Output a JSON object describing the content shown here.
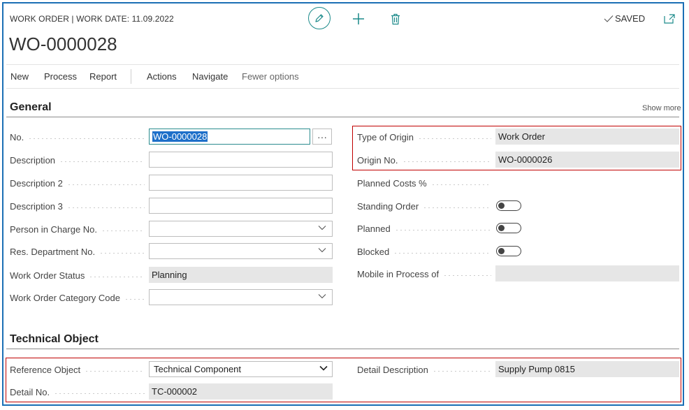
{
  "header": {
    "caption": "WORK ORDER | WORK DATE: 11.09.2022",
    "title": "WO-0000028",
    "saved_label": "SAVED"
  },
  "menu": {
    "items": [
      "New",
      "Process",
      "Report",
      "Actions",
      "Navigate"
    ],
    "fewer_options": "Fewer options"
  },
  "general": {
    "title": "General",
    "show_more": "Show more",
    "no_label": "No.",
    "no_value": "WO-0000028",
    "ellipsis": "···",
    "description_label": "Description",
    "description2_label": "Description 2",
    "description3_label": "Description 3",
    "person_label": "Person in Charge No.",
    "dept_label": "Res. Department No.",
    "status_label": "Work Order Status",
    "status_value": "Planning",
    "category_label": "Work Order Category Code",
    "origin_type_label": "Type of Origin",
    "origin_type_value": "Work Order",
    "origin_no_label": "Origin No.",
    "origin_no_value": "WO-0000026",
    "planned_costs_label": "Planned Costs %",
    "standing_label": "Standing Order",
    "planned_label": "Planned",
    "blocked_label": "Blocked",
    "mobile_label": "Mobile in Process of"
  },
  "technical": {
    "title": "Technical Object",
    "ref_label": "Reference Object",
    "ref_value": "Technical Component",
    "detail_no_label": "Detail No.",
    "detail_no_value": "TC-000002",
    "detail_desc_label": "Detail Description",
    "detail_desc_value": "Supply Pump 0815"
  },
  "colors": {
    "accent": "#1b8a8a",
    "frame": "#1b6fb5",
    "highlight": "#c00000",
    "selection": "#1e6fc9"
  }
}
